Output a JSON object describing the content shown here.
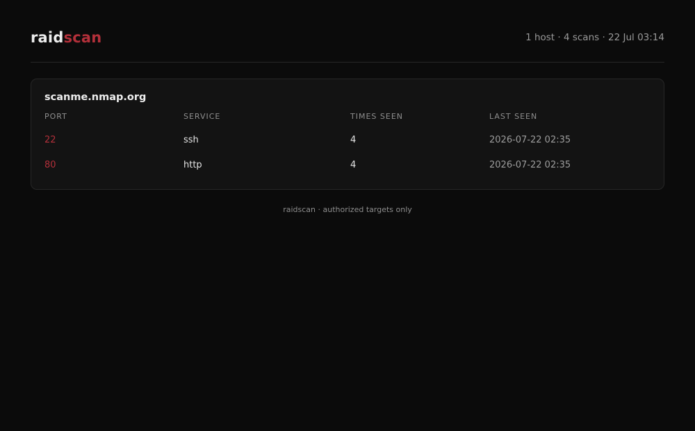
{
  "header": {
    "brand_part1": "raid",
    "brand_part2": "scan",
    "meta": "1 host · 4 scans · 22 Jul 03:14"
  },
  "host_card": {
    "hostname": "scanme.nmap.org",
    "columns": [
      "PORT",
      "SERVICE",
      "TIMES SEEN",
      "LAST SEEN"
    ],
    "rows": [
      {
        "port": "22",
        "service": "ssh",
        "times_seen": "4",
        "last_seen": "2026-07-22 02:35"
      },
      {
        "port": "80",
        "service": "http",
        "times_seen": "4",
        "last_seen": "2026-07-22 02:35"
      }
    ]
  },
  "footer": {
    "text": "raidscan · authorized targets only"
  },
  "colors": {
    "background": "#0b0b0b",
    "accent": "#b3303a",
    "card": "#131313"
  }
}
